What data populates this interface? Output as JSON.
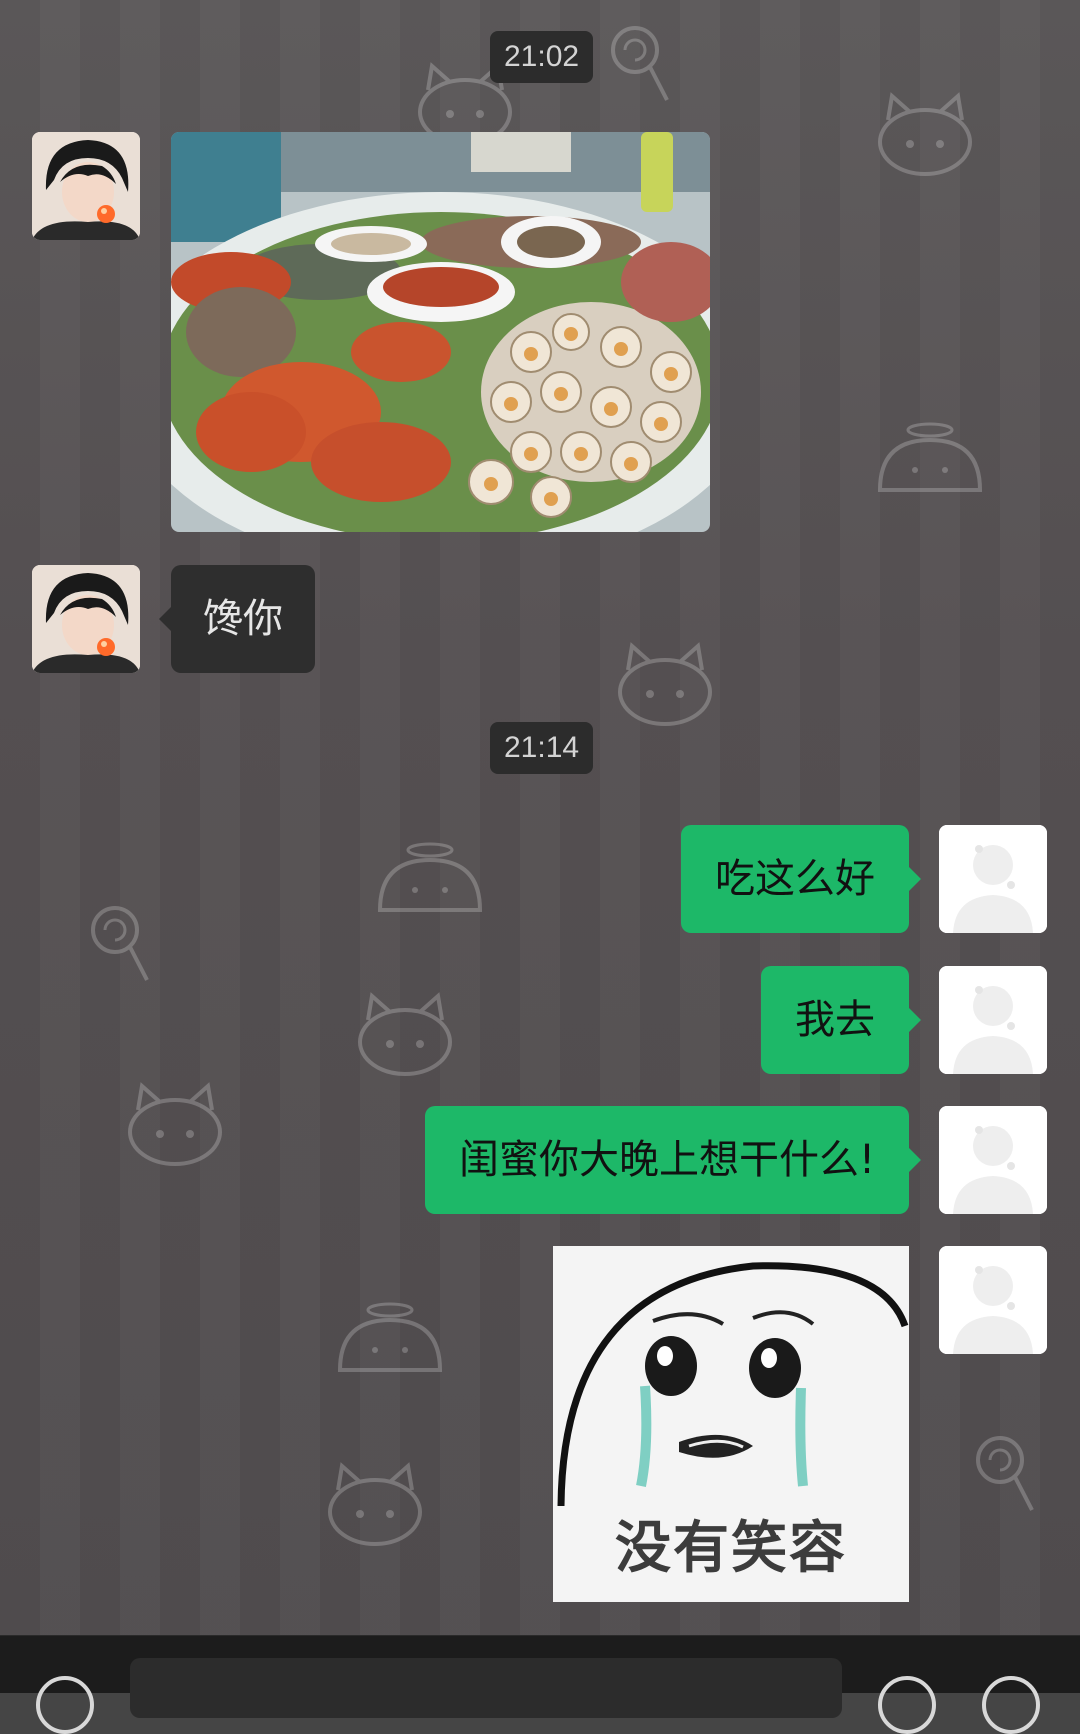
{
  "colors": {
    "outgoing_bubble": "#1db868",
    "incoming_bubble": "#2e2e2e",
    "timestamp_pill": "#2c2c2c"
  },
  "messages": {
    "time_1": "21:02",
    "time_2": "21:14",
    "incoming_text_1": "馋你",
    "outgoing_text_1": "吃这么好",
    "outgoing_text_2": "我去",
    "outgoing_text_3": "闺蜜你大晚上想干什么!",
    "sticker_caption": "没有笑容"
  },
  "input_bar": {
    "left_icon": "voice-icon",
    "right_icon_1": "emoji-icon",
    "right_icon_2": "add-icon"
  }
}
